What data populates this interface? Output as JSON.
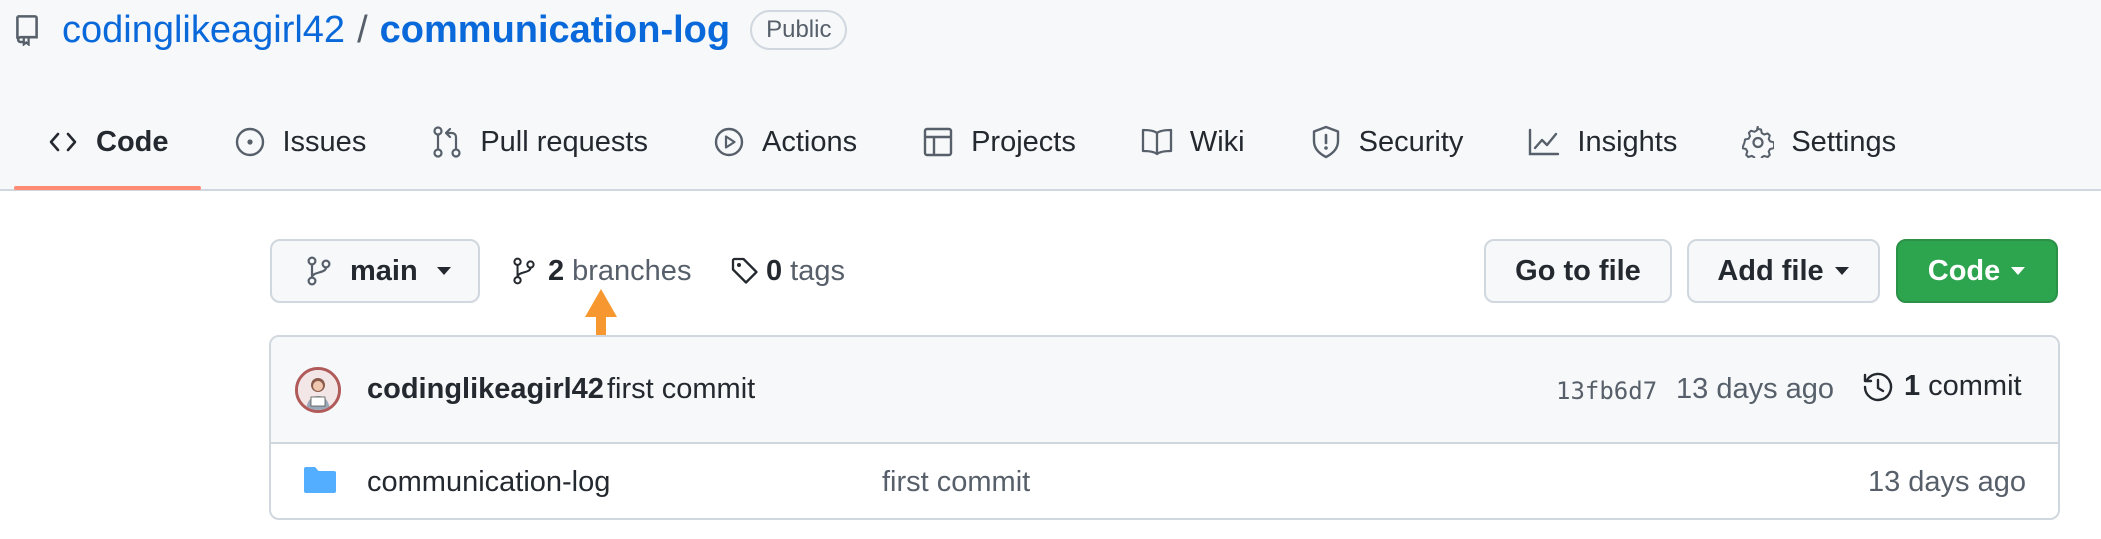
{
  "repo": {
    "owner": "codinglikeagirl42",
    "separator": "/",
    "name": "communication-log",
    "visibility": "Public",
    "icon": "repo-icon"
  },
  "tabs": [
    {
      "label": "Code",
      "icon": "code-icon",
      "active": true
    },
    {
      "label": "Issues",
      "icon": "issue-opened-icon",
      "active": false
    },
    {
      "label": "Pull requests",
      "icon": "git-pull-request-icon",
      "active": false
    },
    {
      "label": "Actions",
      "icon": "play-icon",
      "active": false
    },
    {
      "label": "Projects",
      "icon": "table-icon",
      "active": false
    },
    {
      "label": "Wiki",
      "icon": "book-icon",
      "active": false
    },
    {
      "label": "Security",
      "icon": "shield-icon",
      "active": false
    },
    {
      "label": "Insights",
      "icon": "graph-icon",
      "active": false
    },
    {
      "label": "Settings",
      "icon": "gear-icon",
      "active": false
    }
  ],
  "branch_bar": {
    "current_branch": "main",
    "branches_count": "2",
    "branches_label": "branches",
    "tags_count": "0",
    "tags_label": "tags",
    "go_to_file": "Go to file",
    "add_file": "Add file",
    "code": "Code"
  },
  "latest_commit": {
    "author": "codinglikeagirl42",
    "message": "first commit",
    "sha": "13fb6d7",
    "time": "13 days ago",
    "commit_count": "1",
    "commit_label": "commit"
  },
  "files": [
    {
      "type": "folder",
      "name": "communication-log",
      "message": "first commit",
      "time": "13 days ago"
    }
  ],
  "colors": {
    "accent_tab": "#fd8c73",
    "link": "#0969da",
    "primary_button": "#2da44e",
    "annotation_arrow": "#f6982f",
    "folder": "#54aeff"
  }
}
